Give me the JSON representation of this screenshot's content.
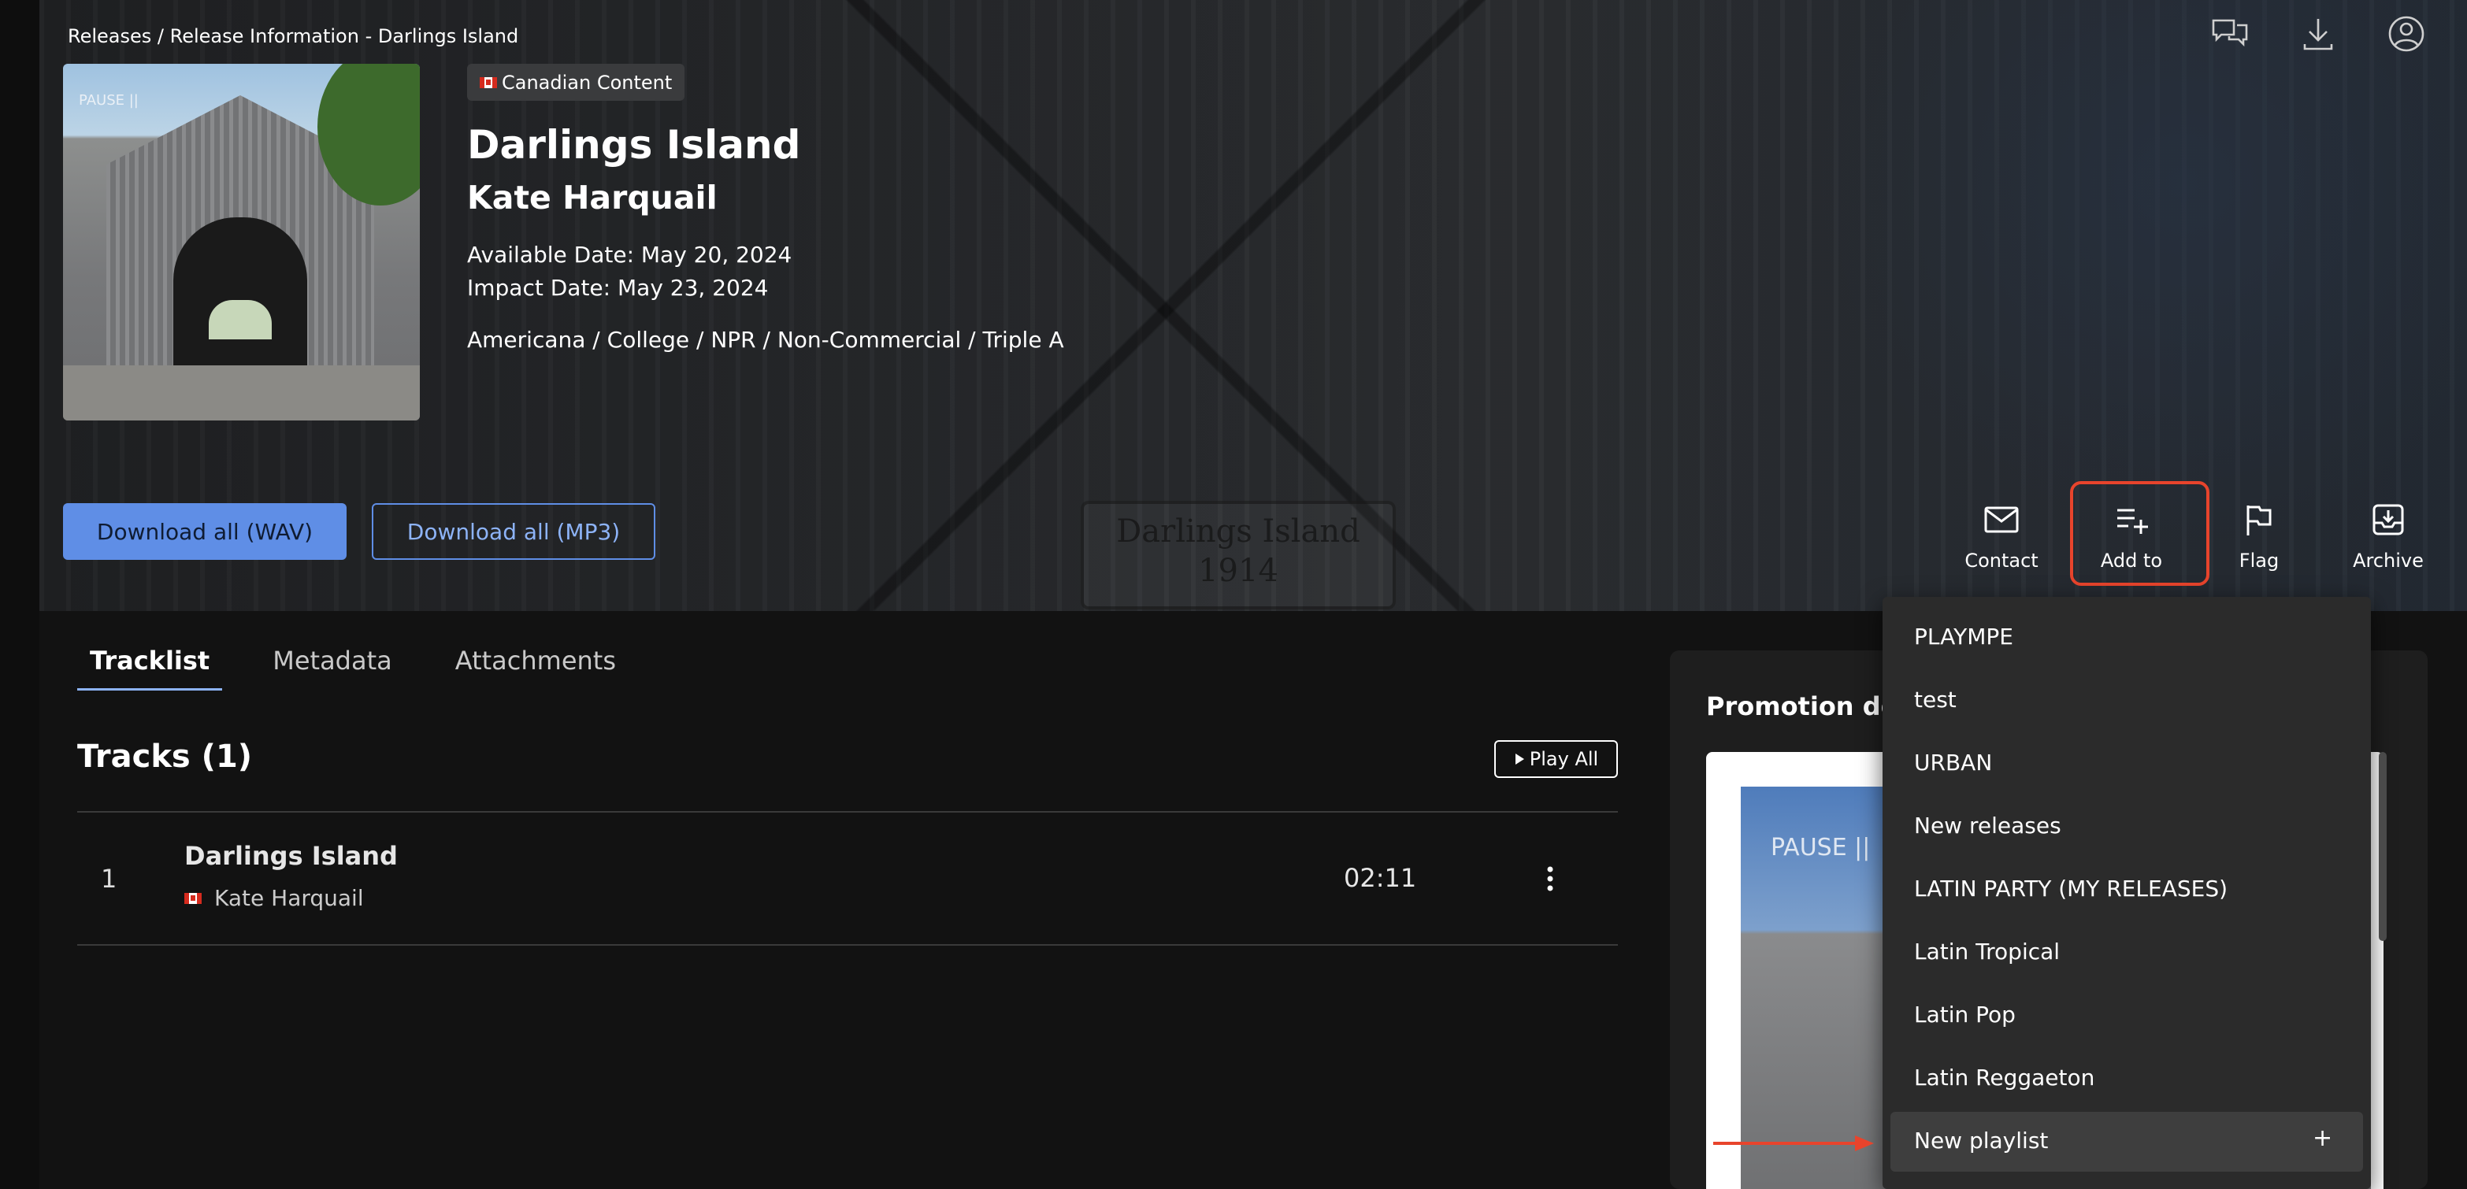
{
  "breadcrumb": "Releases / Release Information - Darlings Island",
  "release": {
    "badge": "Canadian Content",
    "title": "Darlings Island",
    "artist": "Kate Harquail",
    "available_date": "Available Date: May 20, 2024",
    "impact_date": "Impact Date: May 23, 2024",
    "genres": "Americana / College / NPR / Non-Commercial / Triple A",
    "cover_text": "PAUSE ||"
  },
  "hero": {
    "sign_line1": "Darlings Island",
    "sign_line2": "1914"
  },
  "buttons": {
    "download_wav": "Download all (WAV)",
    "download_mp3": "Download all (MP3)"
  },
  "actions": {
    "contact": "Contact",
    "add_to": "Add to",
    "flag": "Flag",
    "archive": "Archive"
  },
  "top_icons": [
    "messages-icon",
    "download-icon",
    "user-icon"
  ],
  "tabs": [
    "Tracklist",
    "Metadata",
    "Attachments"
  ],
  "tracks": {
    "heading": "Tracks (1)",
    "play_all": "Play All",
    "rows": [
      {
        "number": "1",
        "title": "Darlings Island",
        "artist": "Kate Harquail",
        "duration": "02:11"
      }
    ]
  },
  "promotion": {
    "title": "Promotion deta",
    "image_text": "PAUSE ||"
  },
  "add_to_menu": {
    "items": [
      "PLAYMPE",
      "test",
      "URBAN",
      "New releases",
      "LATIN PARTY (MY RELEASES)",
      "Latin Tropical",
      "Latin Pop",
      "Latin Reggaeton"
    ],
    "new_playlist": "New playlist",
    "plus": "+"
  },
  "colors": {
    "accent_blue": "#5f8ee6",
    "highlight_red": "#e8442c",
    "background": "#121212"
  }
}
